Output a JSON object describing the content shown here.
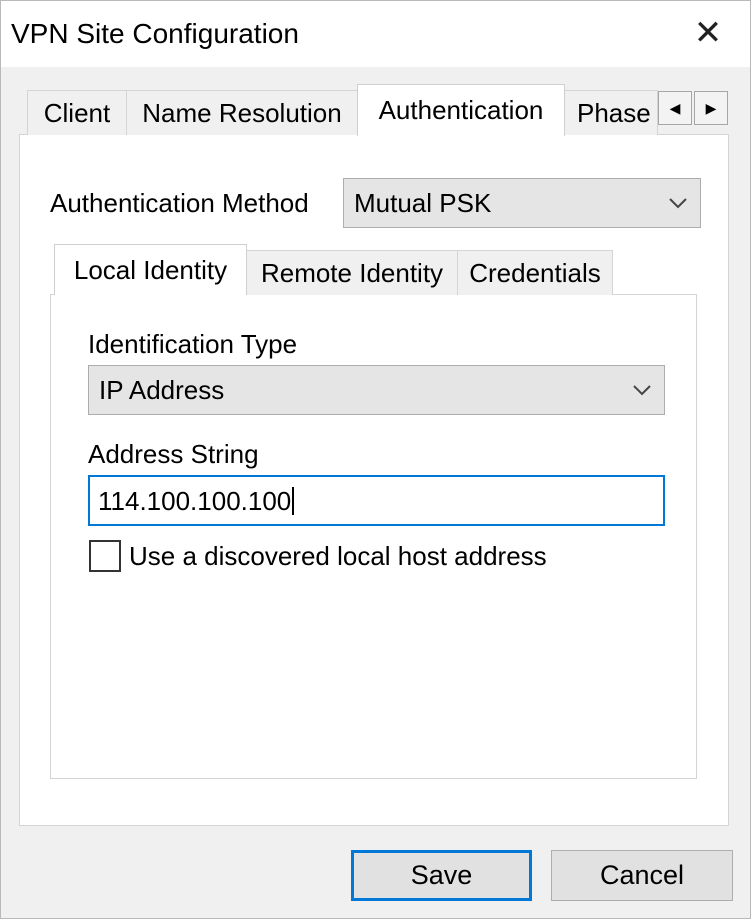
{
  "window": {
    "title": "VPN Site Configuration",
    "close_glyph": "✕"
  },
  "outer_tabs": {
    "items": [
      "Client",
      "Name Resolution",
      "Authentication",
      "Phase"
    ],
    "active": "Authentication",
    "scroll_left_glyph": "◀",
    "scroll_right_glyph": "▶"
  },
  "auth": {
    "method_label": "Authentication Method",
    "method_value": "Mutual PSK"
  },
  "inner_tabs": {
    "items": [
      "Local Identity",
      "Remote Identity",
      "Credentials"
    ],
    "active": "Local Identity"
  },
  "local_identity": {
    "id_type_label": "Identification Type",
    "id_type_value": "IP Address",
    "address_label": "Address String",
    "address_value": "114.100.100.100",
    "checkbox_label": "Use a discovered local host address",
    "checkbox_checked": false
  },
  "buttons": {
    "save": "Save",
    "cancel": "Cancel"
  },
  "colors": {
    "focus_accent": "#0078d7",
    "dialog_bg": "#f0f0f0",
    "panel_bg": "#ffffff"
  }
}
